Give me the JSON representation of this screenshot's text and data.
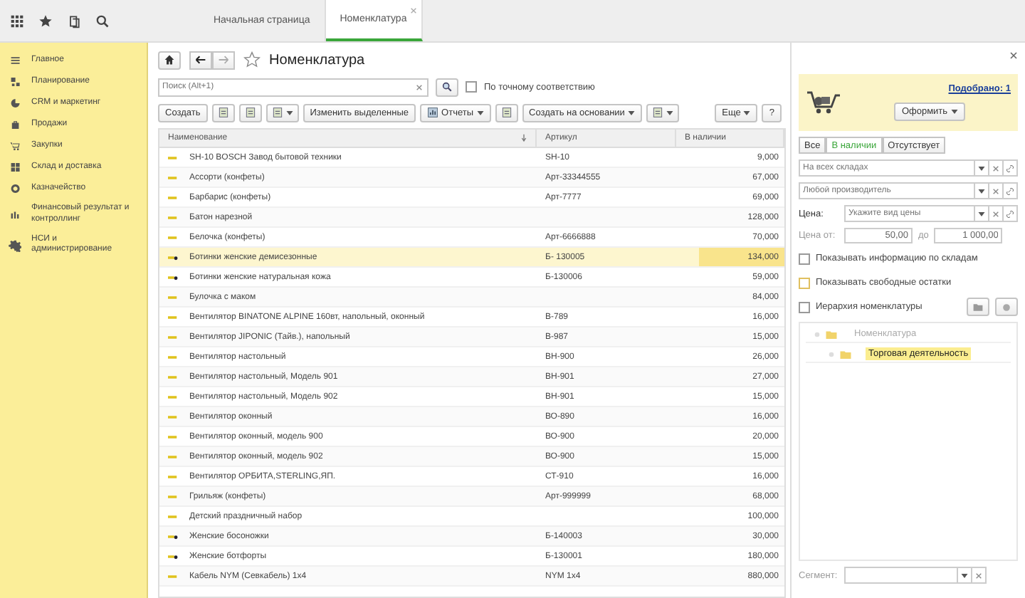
{
  "top_bar": {
    "tabs": [
      {
        "label": "Начальная страница",
        "selected": false,
        "closable": false
      },
      {
        "label": "Номенклатура",
        "selected": true,
        "closable": true
      }
    ]
  },
  "sidebar": {
    "items": [
      {
        "label": "Главное"
      },
      {
        "label": "Планирование"
      },
      {
        "label": "CRM и маркетинг"
      },
      {
        "label": "Продажи"
      },
      {
        "label": "Закупки"
      },
      {
        "label": "Склад и доставка"
      },
      {
        "label": "Казначейство"
      },
      {
        "label": "Финансовый результат и контроллинг"
      },
      {
        "label": "НСИ и администрирование"
      }
    ]
  },
  "form": {
    "title": "Номенклатура",
    "search": {
      "placeholder": "Поиск (Alt+1)"
    },
    "exact_match": {
      "label": "По точному соответствию",
      "checked": false
    },
    "toolbar": [
      {
        "kind": "button",
        "label": "Создать",
        "caret": false,
        "icon": false
      },
      {
        "kind": "icon",
        "caret": false
      },
      {
        "kind": "icon",
        "caret": false
      },
      {
        "kind": "icon",
        "caret": true
      },
      {
        "kind": "button",
        "label": "Изменить выделенные",
        "caret": false,
        "icon": false
      },
      {
        "kind": "button",
        "label": "Отчеты",
        "caret": true,
        "icon": true
      },
      {
        "kind": "icon",
        "caret": false
      },
      {
        "kind": "button",
        "label": "Создать на основании",
        "caret": true,
        "icon": false
      },
      {
        "kind": "icon",
        "caret": true
      },
      {
        "kind": "spacer"
      },
      {
        "kind": "button",
        "label": "Еще",
        "caret": true,
        "icon": false
      },
      {
        "kind": "button",
        "label": "?",
        "caret": false,
        "icon": false
      }
    ],
    "table": {
      "columns": [
        {
          "label": "Наименование",
          "sorted": true
        },
        {
          "label": "Артикул",
          "sorted": false
        },
        {
          "label": "В наличии",
          "sorted": false
        }
      ],
      "rows": [
        {
          "name": "SH-10 BOSCH Завод бытовой техники",
          "article": "SH-10",
          "stock": "9,000",
          "kind": "item",
          "selected": false
        },
        {
          "name": "Ассорти (конфеты)",
          "article": "Арт-33344555",
          "stock": "67,000",
          "kind": "item",
          "selected": false
        },
        {
          "name": "Барбарис (конфеты)",
          "article": "Арт-7777",
          "stock": "69,000",
          "kind": "item",
          "selected": false
        },
        {
          "name": "Батон нарезной",
          "article": "",
          "stock": "128,000",
          "kind": "item",
          "selected": false
        },
        {
          "name": "Белочка (конфеты)",
          "article": "Арт-6666888",
          "stock": "70,000",
          "kind": "item",
          "selected": false
        },
        {
          "name": "Ботинки женские демисезонные",
          "article": "Б- 130005",
          "stock": "134,000",
          "kind": "variant",
          "selected": true
        },
        {
          "name": "Ботинки женские натуральная кожа",
          "article": "Б-130006",
          "stock": "59,000",
          "kind": "variant",
          "selected": false
        },
        {
          "name": "Булочка с маком",
          "article": "",
          "stock": "84,000",
          "kind": "item",
          "selected": false
        },
        {
          "name": "Вентилятор BINATONE ALPINE 160вт, напольный, оконный",
          "article": "В-789",
          "stock": "16,000",
          "kind": "item",
          "selected": false
        },
        {
          "name": "Вентилятор JIPONIC (Тайв.), напольный",
          "article": "В-987",
          "stock": "15,000",
          "kind": "item",
          "selected": false
        },
        {
          "name": "Вентилятор настольный",
          "article": "ВН-900",
          "stock": "26,000",
          "kind": "item",
          "selected": false
        },
        {
          "name": "Вентилятор настольный, Модель 901",
          "article": "ВН-901",
          "stock": "27,000",
          "kind": "item",
          "selected": false
        },
        {
          "name": "Вентилятор настольный, Модель 902",
          "article": "ВН-901",
          "stock": "15,000",
          "kind": "item",
          "selected": false
        },
        {
          "name": "Вентилятор оконный",
          "article": "ВО-890",
          "stock": "16,000",
          "kind": "item",
          "selected": false
        },
        {
          "name": "Вентилятор оконный, модель 900",
          "article": "ВО-900",
          "stock": "20,000",
          "kind": "item",
          "selected": false
        },
        {
          "name": "Вентилятор оконный, модель 902",
          "article": "ВО-900",
          "stock": "15,000",
          "kind": "item",
          "selected": false
        },
        {
          "name": "Вентилятор ОРБИТА,STERLING,ЯП.",
          "article": "СТ-910",
          "stock": "16,000",
          "kind": "item",
          "selected": false
        },
        {
          "name": "Грильяж (конфеты)",
          "article": "Арт-999999",
          "stock": "68,000",
          "kind": "item",
          "selected": false
        },
        {
          "name": "Детский праздничный набор",
          "article": "",
          "stock": "100,000",
          "kind": "item",
          "selected": false
        },
        {
          "name": "Женские босоножки",
          "article": "Б-140003",
          "stock": "30,000",
          "kind": "variant",
          "selected": false
        },
        {
          "name": "Женские ботфорты",
          "article": "Б-130001",
          "stock": "180,000",
          "kind": "variant",
          "selected": false
        },
        {
          "name": "Кабель NYM (Севкабель) 1х4",
          "article": "NYM 1х4",
          "stock": "880,000",
          "kind": "item",
          "selected": false
        }
      ]
    }
  },
  "panel": {
    "selected_link": "Подобрано: 1",
    "checkout_button": "Оформить",
    "filter_tabs": [
      {
        "label": "Все",
        "selected": false
      },
      {
        "label": "В наличии",
        "selected": true
      },
      {
        "label": "Отсутствует",
        "selected": false
      }
    ],
    "warehouse": {
      "placeholder": "На всех складах"
    },
    "manufacturer": {
      "placeholder": "Любой производитель"
    },
    "price_type": {
      "label": "Цена:",
      "placeholder": "Укажите вид цены"
    },
    "price_range": {
      "label": "Цена от:",
      "from": "50,00",
      "to_label": "до",
      "to": "1 000,00"
    },
    "options": [
      {
        "label": "Показывать информацию по складам",
        "checked": false
      },
      {
        "label": "Показывать свободные остатки",
        "checked": false
      }
    ],
    "hierarchy": {
      "label": "Иерархия номенклатуры",
      "checked": false
    },
    "tree": [
      {
        "label": "Номенклатура",
        "selected": false,
        "children": [
          {
            "label": "Торговая деятельность",
            "selected": true
          }
        ]
      }
    ],
    "segment": {
      "label": "Сегмент:"
    }
  }
}
